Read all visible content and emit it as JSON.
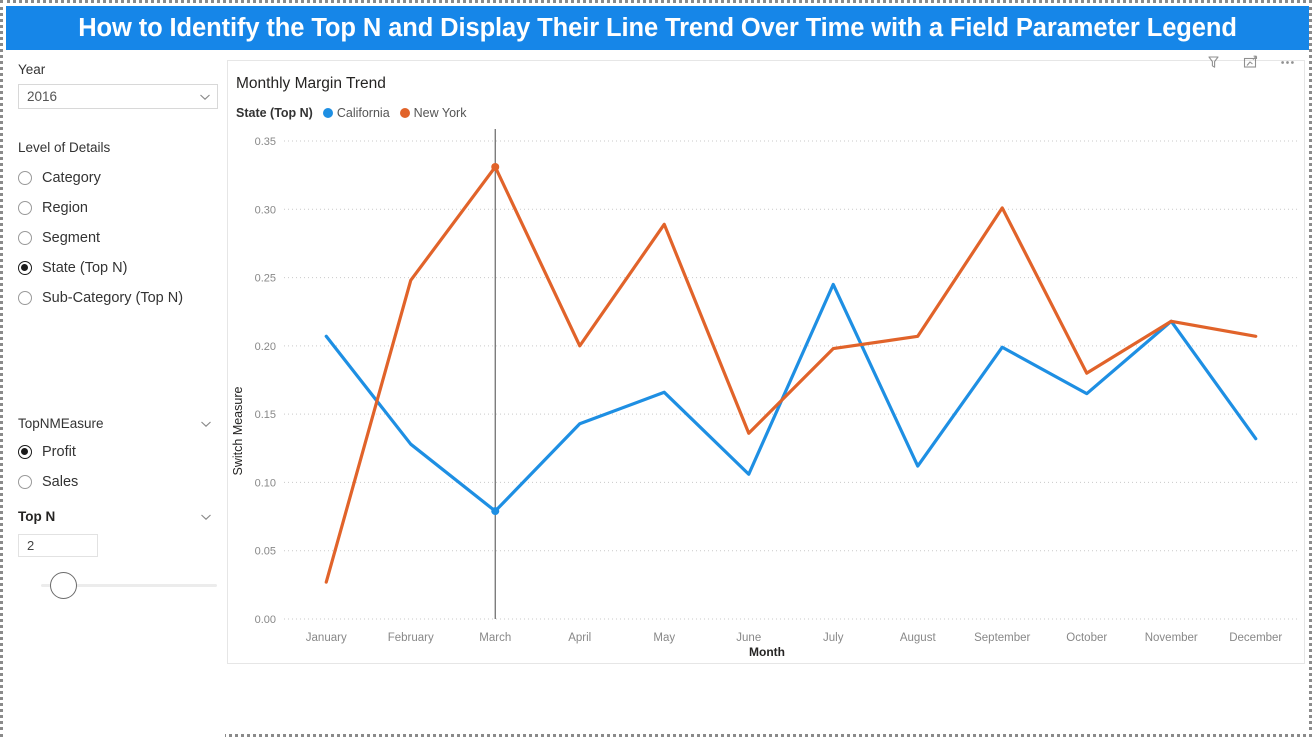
{
  "page": {
    "title": "How to Identify the Top N and Display Their Line Trend Over Time with a Field Parameter Legend",
    "accent_blue": "#1686E8"
  },
  "sidebar": {
    "year_slicer": {
      "label": "Year",
      "value": "2016",
      "dropdown_icon": "chevron-down-icon"
    },
    "level_of_details": {
      "label": "Level of Details",
      "options": [
        {
          "label": "Category",
          "selected": false
        },
        {
          "label": "Region",
          "selected": false
        },
        {
          "label": "Segment",
          "selected": false
        },
        {
          "label": "State (Top N)",
          "selected": true
        },
        {
          "label": "Sub-Category (Top N)",
          "selected": false
        }
      ]
    },
    "measure_slicer": {
      "label": "TopNMEasure",
      "dropdown_icon": "chevron-down-icon",
      "options": [
        {
          "label": "Profit",
          "selected": true
        },
        {
          "label": "Sales",
          "selected": false
        }
      ]
    },
    "topn_slicer": {
      "label": "Top N",
      "dropdown_icon": "chevron-down-icon",
      "value": "2",
      "slider_position_pct": 6
    }
  },
  "chart_card": {
    "title": "Monthly Margin Trend",
    "header_icons": [
      {
        "name": "filter-icon"
      },
      {
        "name": "focus-mode-icon"
      },
      {
        "name": "more-options-icon"
      }
    ],
    "legend": {
      "title": "State (Top N)",
      "items": [
        {
          "label": "California",
          "color": "#1E8FE3"
        },
        {
          "label": "New York",
          "color": "#E1632A"
        }
      ]
    }
  },
  "chart_data": {
    "type": "line",
    "title": "Monthly Margin Trend",
    "xlabel": "Month",
    "ylabel": "Switch Measure",
    "ylim": [
      0.0,
      0.35
    ],
    "yticks": [
      "0.00",
      "0.05",
      "0.10",
      "0.15",
      "0.20",
      "0.25",
      "0.30",
      "0.35"
    ],
    "ytick_values": [
      0.0,
      0.05,
      0.1,
      0.15,
      0.2,
      0.25,
      0.3,
      0.35
    ],
    "grid": true,
    "legend_position": "top-left",
    "categories": [
      "January",
      "February",
      "March",
      "April",
      "May",
      "June",
      "July",
      "August",
      "September",
      "October",
      "November",
      "December"
    ],
    "series": [
      {
        "name": "California",
        "color": "#1E8FE3",
        "values": [
          0.207,
          0.128,
          0.079,
          0.143,
          0.166,
          0.106,
          0.245,
          0.112,
          0.199,
          0.165,
          0.218,
          0.132
        ]
      },
      {
        "name": "New York",
        "color": "#E1632A",
        "values": [
          0.027,
          0.248,
          0.331,
          0.2,
          0.289,
          0.136,
          0.198,
          0.207,
          0.301,
          0.18,
          0.218,
          0.207
        ]
      }
    ],
    "annotations": [
      {
        "name": "hover-reference-line",
        "type": "vertical-line",
        "at_category": "March",
        "color": "#666666"
      }
    ],
    "highlighted_points": [
      {
        "series": "California",
        "category": "March",
        "value": 0.079
      },
      {
        "series": "New York",
        "category": "March",
        "value": 0.331
      }
    ]
  }
}
